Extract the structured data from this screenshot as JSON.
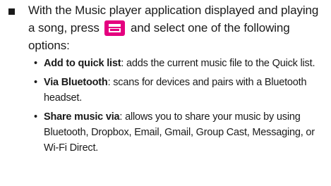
{
  "intro": {
    "bullet_icon": "square-bullet",
    "text_before_icon": "With the Music player application displayed and playing a song, press",
    "menu_icon": "menu-key-icon",
    "menu_icon_color": "#e4007f",
    "text_after_icon": "and select one of the following options:"
  },
  "options": [
    {
      "bullet": "•",
      "term": "Add to quick list",
      "description": ": adds the current music file to the Quick list."
    },
    {
      "bullet": "•",
      "term": "Via Bluetooth",
      "description": ": scans for devices and pairs with a Bluetooth headset."
    },
    {
      "bullet": "•",
      "term": "Share music via",
      "description": ": allows you to share your music by using Bluetooth, Dropbox, Email, Gmail, Group Cast, Messaging, or Wi-Fi Direct."
    }
  ]
}
